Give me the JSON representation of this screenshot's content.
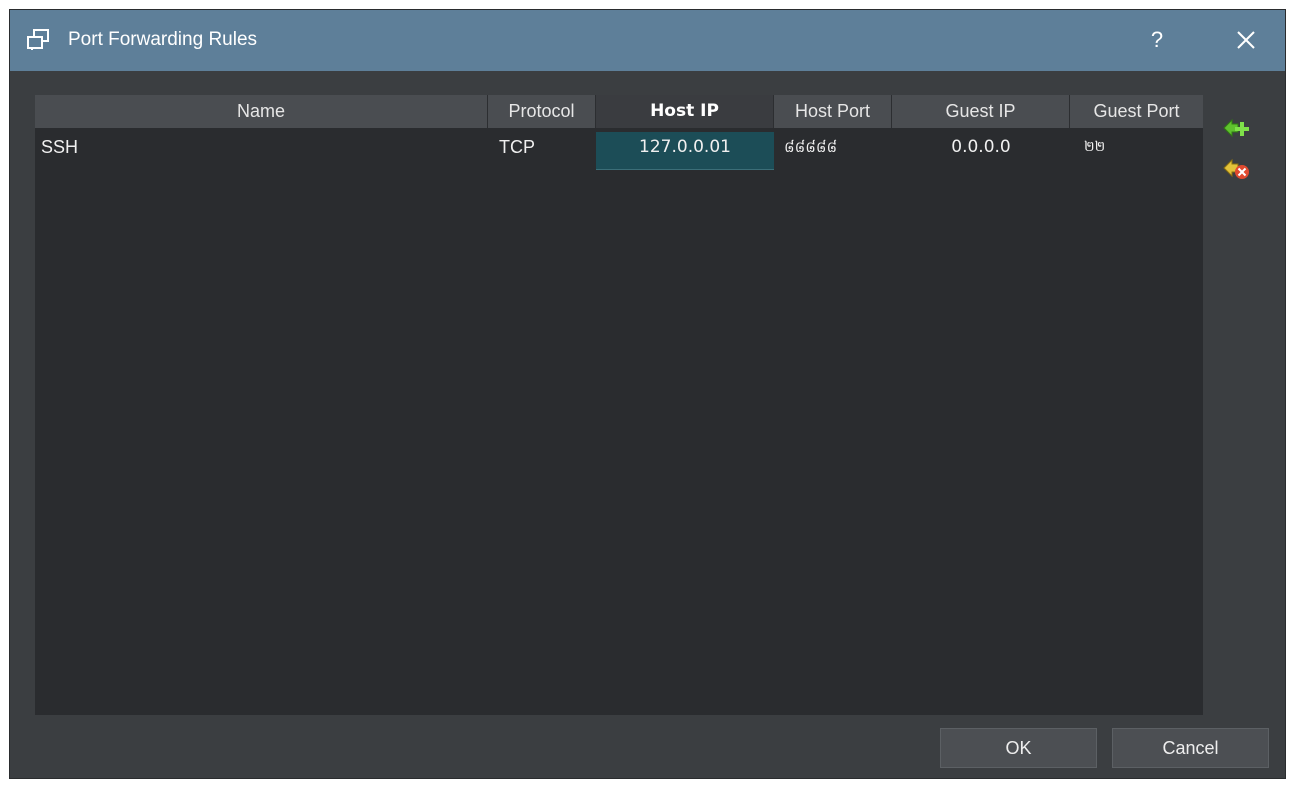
{
  "window": {
    "title": "Port Forwarding Rules",
    "help_label": "?",
    "icons": {
      "title": "port-forwarding-icon",
      "close": "close-icon"
    }
  },
  "table": {
    "columns": [
      "Name",
      "Protocol",
      "Host IP",
      "Host Port",
      "Guest IP",
      "Guest Port"
    ],
    "sorted_column": "Host IP",
    "rows": [
      {
        "name": "SSH",
        "protocol": "TCP",
        "host_ip": "127.0.0.01",
        "host_port": "៨៨៨៨៨",
        "guest_ip": "0.0.0.0",
        "guest_port": "២២"
      }
    ]
  },
  "side_buttons": [
    {
      "name": "add-rule-button",
      "icon": "add-rule-icon"
    },
    {
      "name": "remove-rule-button",
      "icon": "remove-rule-icon"
    }
  ],
  "buttons": {
    "ok": "OK",
    "cancel": "Cancel"
  },
  "colors": {
    "titlebar": "#5e7f99",
    "body": "#3b3e41",
    "table_bg": "#2a2c2f",
    "header_bg": "#4a4d51",
    "selected_cell": "#1c4d57",
    "add_icon": "#5fc12e",
    "remove_icon": "#e04a2f"
  }
}
